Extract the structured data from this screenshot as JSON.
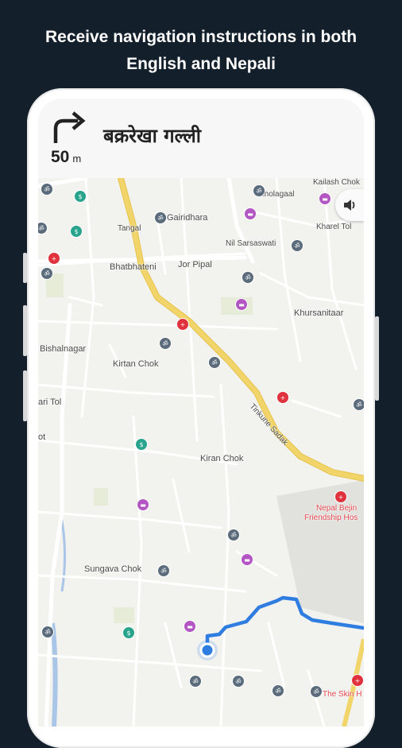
{
  "headline": {
    "line1": "Receive navigation instructions in both",
    "line2": "English and Nepali"
  },
  "navigation": {
    "turn_icon": "turn-right-arrow-icon",
    "distance_value": "50",
    "distance_unit": "m",
    "street_name": "बक्ररेखा गल्ली"
  },
  "map": {
    "labels": [
      "Kailash Chok",
      "Kholagaal",
      "Gairidhara",
      "Tangal",
      "Kharel Tol",
      "Nil Sarsaswati",
      "Bhatbhateni",
      "Jor Pipal",
      "Khursanitaar",
      "Bishalnagar",
      "Kirtan Chok",
      "Tinkune Sadak",
      "ari Tol",
      "ot",
      "Kiran Chok",
      "Sungava Chok"
    ],
    "red_labels": [
      "Nepal Bejin",
      "Friendship Hos",
      "The Skin H"
    ],
    "volume_icon": "volume-icon",
    "location_icon": "current-location-icon",
    "colors": {
      "major_road": "#f2d56a",
      "route": "#2f7de1",
      "background": "#f2f2ef",
      "hospital": "#e0323c",
      "hotel": "#b356c4",
      "temple": "#5a6b7b",
      "bank": "#28a38c"
    }
  }
}
